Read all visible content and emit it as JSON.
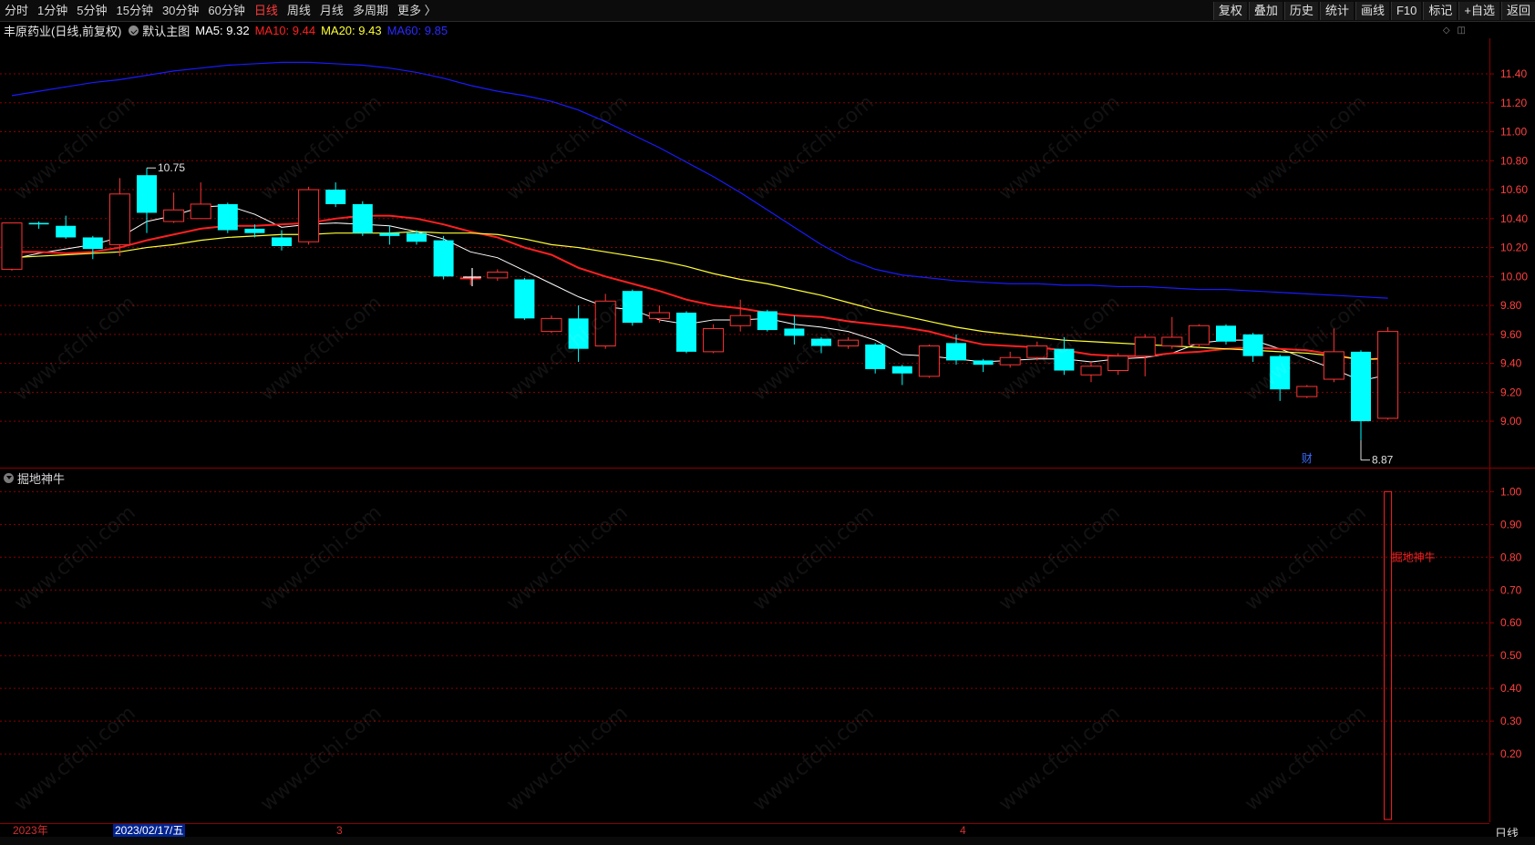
{
  "toolbar": {
    "periods": [
      "分时",
      "1分钟",
      "5分钟",
      "15分钟",
      "30分钟",
      "60分钟",
      "日线",
      "周线",
      "月线",
      "多周期",
      "更多 〉"
    ],
    "active_period": "日线",
    "tools": [
      "复权",
      "叠加",
      "历史",
      "统计",
      "画线",
      "F10",
      "标记",
      "+自选",
      "返回"
    ]
  },
  "info": {
    "stock": "丰原药业(日线,前复权)",
    "template": "默认主图",
    "ma5": "MA5: 9.32",
    "ma10": "MA10: 9.44",
    "ma20": "MA20: 9.43",
    "ma60": "MA60: 9.85"
  },
  "indicator": {
    "title": "掘地神牛",
    "signal_label": "掘地神牛"
  },
  "date_axis": {
    "year": "2023年",
    "cursor": "2023/02/17/五",
    "m3": "3",
    "m4": "4"
  },
  "period_label": "日线",
  "watermark": "www.cfchi.com",
  "colors": {
    "up": "#ff3333",
    "down": "#00ffff",
    "ma5": "#ffffff",
    "ma10": "#ff2020",
    "ma20": "#ffff33",
    "ma60": "#1a1aff",
    "grid": "#8b0000",
    "axis_text": "#ff4040"
  },
  "chart_data": [
    {
      "type": "candlestick",
      "title": "丰原药业(日线,前复权)",
      "ylim": [
        8.78,
        11.52
      ],
      "y_ticks": [
        9.0,
        9.2,
        9.4,
        9.6,
        9.8,
        10.0,
        10.2,
        10.4,
        10.6,
        10.8,
        11.0,
        11.2,
        11.4
      ],
      "high_marker": "10.75",
      "low_marker": "8.87",
      "event_marker": "财",
      "candles": [
        {
          "o": 10.05,
          "c": 10.37,
          "h": 10.37,
          "l": 10.04
        },
        {
          "o": 10.37,
          "c": 10.36,
          "h": 10.38,
          "l": 10.33
        },
        {
          "o": 10.35,
          "c": 10.27,
          "h": 10.42,
          "l": 10.26
        },
        {
          "o": 10.27,
          "c": 10.19,
          "h": 10.28,
          "l": 10.12
        },
        {
          "o": 10.22,
          "c": 10.57,
          "h": 10.68,
          "l": 10.14
        },
        {
          "o": 10.7,
          "c": 10.44,
          "h": 10.75,
          "l": 10.3
        },
        {
          "o": 10.38,
          "c": 10.46,
          "h": 10.58,
          "l": 10.37
        },
        {
          "o": 10.4,
          "c": 10.5,
          "h": 10.65,
          "l": 10.4
        },
        {
          "o": 10.5,
          "c": 10.32,
          "h": 10.51,
          "l": 10.3
        },
        {
          "o": 10.33,
          "c": 10.3,
          "h": 10.36,
          "l": 10.27
        },
        {
          "o": 10.27,
          "c": 10.21,
          "h": 10.32,
          "l": 10.18
        },
        {
          "o": 10.24,
          "c": 10.6,
          "h": 10.62,
          "l": 10.22
        },
        {
          "o": 10.6,
          "c": 10.5,
          "h": 10.65,
          "l": 10.48
        },
        {
          "o": 10.5,
          "c": 10.3,
          "h": 10.52,
          "l": 10.28
        },
        {
          "o": 10.3,
          "c": 10.28,
          "h": 10.35,
          "l": 10.22
        },
        {
          "o": 10.3,
          "c": 10.24,
          "h": 10.32,
          "l": 10.22
        },
        {
          "o": 10.25,
          "c": 10.0,
          "h": 10.28,
          "l": 9.98
        },
        {
          "o": 9.99,
          "c": 9.99,
          "h": 10.0,
          "l": 9.94
        },
        {
          "o": 9.99,
          "c": 10.03,
          "h": 10.05,
          "l": 9.97
        },
        {
          "o": 9.98,
          "c": 9.71,
          "h": 9.99,
          "l": 9.7
        },
        {
          "o": 9.62,
          "c": 9.71,
          "h": 9.73,
          "l": 9.61
        },
        {
          "o": 9.71,
          "c": 9.5,
          "h": 9.8,
          "l": 9.41
        },
        {
          "o": 9.52,
          "c": 9.83,
          "h": 9.88,
          "l": 9.5
        },
        {
          "o": 9.9,
          "c": 9.68,
          "h": 9.91,
          "l": 9.66
        },
        {
          "o": 9.71,
          "c": 9.75,
          "h": 9.8,
          "l": 9.68
        },
        {
          "o": 9.75,
          "c": 9.48,
          "h": 9.76,
          "l": 9.47
        },
        {
          "o": 9.48,
          "c": 9.64,
          "h": 9.67,
          "l": 9.47
        },
        {
          "o": 9.66,
          "c": 9.73,
          "h": 9.84,
          "l": 9.62
        },
        {
          "o": 9.76,
          "c": 9.63,
          "h": 9.77,
          "l": 9.62
        },
        {
          "o": 9.64,
          "c": 9.59,
          "h": 9.73,
          "l": 9.53
        },
        {
          "o": 9.57,
          "c": 9.52,
          "h": 9.58,
          "l": 9.47
        },
        {
          "o": 9.52,
          "c": 9.56,
          "h": 9.58,
          "l": 9.5
        },
        {
          "o": 9.53,
          "c": 9.36,
          "h": 9.54,
          "l": 9.33
        },
        {
          "o": 9.38,
          "c": 9.33,
          "h": 9.39,
          "l": 9.25
        },
        {
          "o": 9.31,
          "c": 9.52,
          "h": 9.53,
          "l": 9.3
        },
        {
          "o": 9.54,
          "c": 9.42,
          "h": 9.6,
          "l": 9.39
        },
        {
          "o": 9.42,
          "c": 9.39,
          "h": 9.43,
          "l": 9.34
        },
        {
          "o": 9.39,
          "c": 9.44,
          "h": 9.48,
          "l": 9.37
        },
        {
          "o": 9.44,
          "c": 9.52,
          "h": 9.55,
          "l": 9.42
        },
        {
          "o": 9.5,
          "c": 9.35,
          "h": 9.58,
          "l": 9.32
        },
        {
          "o": 9.32,
          "c": 9.38,
          "h": 9.41,
          "l": 9.27
        },
        {
          "o": 9.35,
          "c": 9.45,
          "h": 9.47,
          "l": 9.32
        },
        {
          "o": 9.45,
          "c": 9.58,
          "h": 9.6,
          "l": 9.31
        },
        {
          "o": 9.52,
          "c": 9.58,
          "h": 9.72,
          "l": 9.5
        },
        {
          "o": 9.53,
          "c": 9.66,
          "h": 9.67,
          "l": 9.51
        },
        {
          "o": 9.66,
          "c": 9.55,
          "h": 9.67,
          "l": 9.53
        },
        {
          "o": 9.6,
          "c": 9.45,
          "h": 9.61,
          "l": 9.41
        },
        {
          "o": 9.45,
          "c": 9.22,
          "h": 9.46,
          "l": 9.14
        },
        {
          "o": 9.17,
          "c": 9.24,
          "h": 9.25,
          "l": 9.16
        },
        {
          "o": 9.29,
          "c": 9.48,
          "h": 9.64,
          "l": 9.27
        },
        {
          "o": 9.48,
          "c": 9.0,
          "h": 9.49,
          "l": 8.87
        },
        {
          "o": 9.02,
          "c": 9.62,
          "h": 9.65,
          "l": 9.01
        }
      ],
      "series": [
        {
          "name": "MA5",
          "values": [
            10.12,
            10.16,
            10.19,
            10.22,
            10.27,
            10.38,
            10.42,
            10.48,
            10.49,
            10.43,
            10.34,
            10.36,
            10.37,
            10.36,
            10.35,
            10.31,
            10.26,
            10.17,
            10.13,
            10.04,
            9.95,
            9.86,
            9.79,
            9.77,
            9.7,
            9.67,
            9.7,
            9.7,
            9.71,
            9.67,
            9.65,
            9.62,
            9.56,
            9.46,
            9.45,
            9.43,
            9.41,
            9.42,
            9.43,
            9.43,
            9.41,
            9.43,
            9.44,
            9.47,
            9.54,
            9.56,
            9.56,
            9.5,
            9.43,
            9.36,
            9.28,
            9.32
          ]
        },
        {
          "name": "MA10",
          "values": [
            10.17,
            10.17,
            10.16,
            10.17,
            10.2,
            10.25,
            10.29,
            10.33,
            10.35,
            10.35,
            10.36,
            10.37,
            10.4,
            10.42,
            10.42,
            10.4,
            10.36,
            10.31,
            10.27,
            10.2,
            10.15,
            10.06,
            10.0,
            9.95,
            9.9,
            9.84,
            9.8,
            9.78,
            9.75,
            9.73,
            9.72,
            9.69,
            9.67,
            9.65,
            9.62,
            9.57,
            9.53,
            9.52,
            9.51,
            9.49,
            9.46,
            9.45,
            9.45,
            9.47,
            9.48,
            9.5,
            9.51,
            9.5,
            9.49,
            9.46,
            9.42,
            9.44
          ]
        },
        {
          "name": "MA20",
          "values": [
            10.13,
            10.14,
            10.15,
            10.16,
            10.17,
            10.2,
            10.22,
            10.25,
            10.27,
            10.28,
            10.29,
            10.29,
            10.3,
            10.3,
            10.3,
            10.31,
            10.3,
            10.3,
            10.29,
            10.26,
            10.22,
            10.2,
            10.17,
            10.14,
            10.11,
            10.07,
            10.02,
            9.98,
            9.95,
            9.91,
            9.87,
            9.82,
            9.77,
            9.73,
            9.69,
            9.65,
            9.62,
            9.6,
            9.58,
            9.56,
            9.55,
            9.54,
            9.53,
            9.52,
            9.51,
            9.5,
            9.49,
            9.48,
            9.47,
            9.45,
            9.43,
            9.43
          ]
        },
        {
          "name": "MA60",
          "values": [
            11.25,
            11.28,
            11.31,
            11.34,
            11.36,
            11.39,
            11.42,
            11.44,
            11.46,
            11.47,
            11.48,
            11.48,
            11.47,
            11.46,
            11.44,
            11.41,
            11.37,
            11.32,
            11.28,
            11.25,
            11.21,
            11.15,
            11.07,
            10.98,
            10.89,
            10.79,
            10.69,
            10.58,
            10.46,
            10.34,
            10.22,
            10.12,
            10.05,
            10.01,
            9.99,
            9.97,
            9.96,
            9.95,
            9.95,
            9.94,
            9.94,
            9.93,
            9.93,
            9.92,
            9.91,
            9.91,
            9.9,
            9.89,
            9.88,
            9.87,
            9.86,
            9.85
          ]
        }
      ]
    },
    {
      "type": "bar",
      "title": "掘地神牛",
      "ylim": [
        0,
        1.04
      ],
      "y_ticks": [
        0.2,
        0.3,
        0.4,
        0.5,
        0.6,
        0.7,
        0.8,
        0.9,
        1.0
      ],
      "values": [
        0,
        0,
        0,
        0,
        0,
        0,
        0,
        0,
        0,
        0,
        0,
        0,
        0,
        0,
        0,
        0,
        0,
        0,
        0,
        0,
        0,
        0,
        0,
        0,
        0,
        0,
        0,
        0,
        0,
        0,
        0,
        0,
        0,
        0,
        0,
        0,
        0,
        0,
        0,
        0,
        0,
        0,
        0,
        0,
        0,
        0,
        0,
        0,
        0,
        0,
        0,
        1
      ]
    }
  ]
}
